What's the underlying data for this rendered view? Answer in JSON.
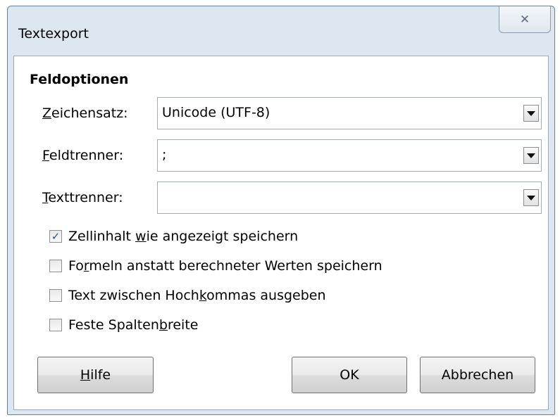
{
  "window": {
    "title": "Textexport",
    "close_glyph": "✕"
  },
  "section": {
    "title": "Feldoptionen"
  },
  "fields": [
    {
      "label": "Zeichensatz:",
      "value": "Unicode (UTF-8)"
    },
    {
      "label": "Feldtrenner:",
      "value": ";"
    },
    {
      "label": "Texttrenner:",
      "value": ""
    }
  ],
  "checkboxes": [
    {
      "label": "Zellinhalt wie angezeigt speichern",
      "checked": true
    },
    {
      "label": "Formeln anstatt berechneter Werten speichern",
      "checked": false
    },
    {
      "label": "Text zwischen Hochkommas ausgeben",
      "checked": false
    },
    {
      "label": "Feste Spaltenbreite",
      "checked": false
    }
  ],
  "buttons": {
    "help": "Hilfe",
    "ok": "OK",
    "cancel": "Abbrechen"
  }
}
